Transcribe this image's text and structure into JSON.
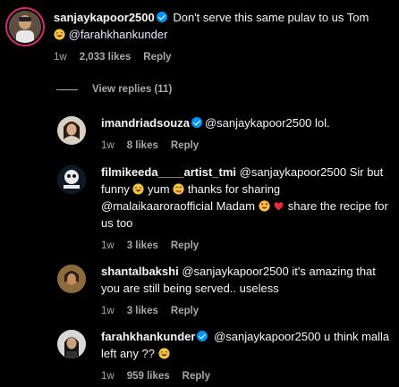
{
  "main_comment": {
    "username": "sanjaykapoor2500",
    "text_a": " Don't serve this same pulav to us Tom ",
    "mention": "@farahkhankunder",
    "time": "1w",
    "likes": "2,033 likes",
    "reply": "Reply"
  },
  "view_replies": {
    "label": "View replies (11)"
  },
  "replies": [
    {
      "username": "imandriadsouza",
      "text": "@sanjaykapoor2500 lol.",
      "time": "1w",
      "likes": "8 likes",
      "reply": "Reply"
    },
    {
      "username": "filmikeeda____artist_tmi",
      "text_a": " @sanjaykapoor2500 Sir but funny ",
      "text_b": "yum ",
      "text_c": " thanks for sharing @malaikaaroraofficial Madam ",
      "text_d": " share the recipe for us too",
      "time": "1w",
      "likes": "3 likes",
      "reply": "Reply"
    },
    {
      "username": "shantalbakshi",
      "text": " @sanjaykapoor2500 it's amazing that you are still being served.. useless",
      "time": "1w",
      "likes": "3 likes",
      "reply": "Reply"
    },
    {
      "username": "farahkhankunder",
      "text_a": " @sanjaykapoor2500 u think malla left any ?? ",
      "time": "1w",
      "likes": "959 likes",
      "reply": "Reply"
    }
  ],
  "icons": {
    "verified": "verified-badge-icon",
    "laughing_emoji": "laughing-emoji-icon",
    "savoring_emoji": "savoring-emoji-icon",
    "heart_eyes_emoji": "heart-eyes-emoji-icon",
    "heart_emoji": "red-heart-emoji-icon"
  },
  "colors": {
    "background": "#000000",
    "verified": "#0095f6",
    "muted": "#a8a8a8",
    "story_ring": "#d62976"
  }
}
